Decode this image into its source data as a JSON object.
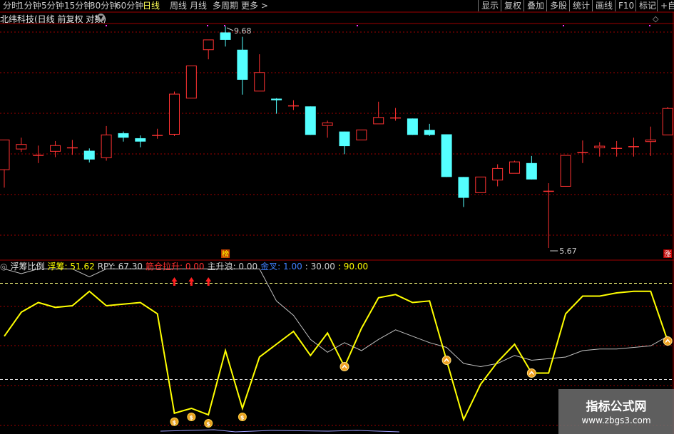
{
  "toolbar": {
    "periods": [
      "分时",
      "1分钟",
      "5分钟",
      "15分钟",
      "30分钟",
      "60分钟",
      "日线",
      "周线",
      "月线",
      "多周期",
      "更多 >"
    ],
    "active_period": "日线",
    "right_buttons": [
      "显示",
      "复权",
      "叠加",
      "多股",
      "统计",
      "画线",
      "F10",
      "标记",
      "+自"
    ]
  },
  "main_chart": {
    "title": "北纬科技(日线 前复权 对数)",
    "high_label": "9.68",
    "low_label": "5.67",
    "marker_bang": "榜",
    "marker_zhang": "涨",
    "candles": [
      {
        "o": 6.85,
        "c": 7.36,
        "h": 7.36,
        "l": 6.56
      },
      {
        "o": 7.2,
        "c": 7.28,
        "h": 7.4,
        "l": 7.15
      },
      {
        "o": 7.1,
        "c": 7.1,
        "h": 7.26,
        "l": 6.96
      },
      {
        "o": 7.16,
        "c": 7.26,
        "h": 7.34,
        "l": 7.06
      },
      {
        "o": 7.23,
        "c": 7.23,
        "h": 7.36,
        "l": 7.1
      },
      {
        "o": 7.17,
        "c": 7.02,
        "h": 7.21,
        "l": 6.97
      },
      {
        "o": 7.05,
        "c": 7.45,
        "h": 7.61,
        "l": 7.0
      },
      {
        "o": 7.48,
        "c": 7.4,
        "h": 7.51,
        "l": 7.33
      },
      {
        "o": 7.39,
        "c": 7.33,
        "h": 7.44,
        "l": 7.23
      },
      {
        "o": 7.45,
        "c": 7.45,
        "h": 7.56,
        "l": 7.38
      },
      {
        "o": 7.46,
        "c": 8.22,
        "h": 8.27,
        "l": 7.43
      },
      {
        "o": 8.14,
        "c": 8.8,
        "h": 8.8,
        "l": 8.14
      },
      {
        "o": 9.15,
        "c": 9.37,
        "h": 9.37,
        "l": 8.94
      },
      {
        "o": 9.54,
        "c": 9.37,
        "h": 9.68,
        "l": 9.22
      },
      {
        "o": 9.15,
        "c": 8.51,
        "h": 9.44,
        "l": 8.21
      },
      {
        "o": 8.28,
        "c": 8.66,
        "h": 9.05,
        "l": 8.28
      },
      {
        "o": 8.13,
        "c": 8.1,
        "h": 8.14,
        "l": 7.84
      },
      {
        "o": 8.0,
        "c": 8.0,
        "h": 8.1,
        "l": 7.91
      },
      {
        "o": 7.98,
        "c": 7.45,
        "h": 7.98,
        "l": 7.45
      },
      {
        "o": 7.62,
        "c": 7.67,
        "h": 7.71,
        "l": 7.4
      },
      {
        "o": 7.51,
        "c": 7.25,
        "h": 7.51,
        "l": 7.11
      },
      {
        "o": 7.36,
        "c": 7.54,
        "h": 7.54,
        "l": 7.36
      },
      {
        "o": 7.65,
        "c": 7.77,
        "h": 8.07,
        "l": 7.65
      },
      {
        "o": 7.77,
        "c": 7.77,
        "h": 7.95,
        "l": 7.71
      },
      {
        "o": 7.75,
        "c": 7.45,
        "h": 7.75,
        "l": 7.45
      },
      {
        "o": 7.54,
        "c": 7.45,
        "h": 7.65,
        "l": 7.43
      },
      {
        "o": 7.46,
        "c": 6.73,
        "h": 7.46,
        "l": 6.73
      },
      {
        "o": 6.73,
        "c": 6.4,
        "h": 6.73,
        "l": 6.26
      },
      {
        "o": 6.48,
        "c": 6.73,
        "h": 6.73,
        "l": 6.48
      },
      {
        "o": 6.68,
        "c": 6.87,
        "h": 6.94,
        "l": 6.58
      },
      {
        "o": 6.79,
        "c": 6.98,
        "h": 7.0,
        "l": 6.79
      },
      {
        "o": 6.96,
        "c": 6.69,
        "h": 7.08,
        "l": 6.69
      },
      {
        "o": 6.51,
        "c": 6.51,
        "h": 6.63,
        "l": 5.67
      },
      {
        "o": 6.58,
        "c": 7.09,
        "h": 7.09,
        "l": 6.58
      },
      {
        "o": 7.15,
        "c": 7.15,
        "h": 7.35,
        "l": 6.96
      },
      {
        "o": 7.22,
        "c": 7.25,
        "h": 7.32,
        "l": 7.07
      },
      {
        "o": 7.22,
        "c": 7.22,
        "h": 7.34,
        "l": 7.07
      },
      {
        "o": 7.25,
        "c": 7.25,
        "h": 7.4,
        "l": 7.07
      },
      {
        "o": 7.33,
        "c": 7.36,
        "h": 7.6,
        "l": 7.08
      },
      {
        "o": 7.45,
        "c": 7.94,
        "h": 7.97,
        "l": 7.45
      }
    ]
  },
  "indicator": {
    "name": "浮筹比例",
    "items": [
      {
        "label": "浮筹: 51.62",
        "color": "#ffff00"
      },
      {
        "label": "RPY: 67.30",
        "color": "#d0d0d0"
      },
      {
        "label": "筋仓拉升: 0.00",
        "color": "#ff3030"
      },
      {
        "label": "主升浪: 0.00",
        "color": "#d0d0d0"
      },
      {
        "label": "金叉: 1.00",
        "color": "#4080ff"
      },
      {
        "label": ": 30.00",
        "color": "#d0d0d0"
      },
      {
        "label": ": 90.00",
        "color": "#ffff00"
      }
    ],
    "yellow": [
      57,
      72,
      78,
      75,
      76,
      85,
      76,
      77,
      78,
      71,
      9,
      12,
      8,
      48,
      12,
      44,
      52,
      60,
      45,
      59,
      38,
      62,
      81,
      83,
      78,
      79,
      42,
      5,
      27,
      41,
      52,
      34,
      34,
      71,
      82,
      82,
      84,
      85,
      85,
      54
    ],
    "white": [
      99,
      96,
      99,
      99,
      99,
      94,
      99,
      99,
      99,
      99,
      99,
      99,
      99,
      99,
      99,
      99,
      79,
      70,
      55,
      47,
      53,
      48,
      55,
      61,
      57,
      53,
      50,
      40,
      38,
      40,
      45,
      42,
      43,
      44,
      48,
      49,
      49,
      50,
      51,
      57
    ],
    "ref_line_high": 90,
    "ref_line_low": 30,
    "arrow_indices": [
      10,
      11,
      12
    ],
    "money_indices": [
      10,
      11,
      12,
      14
    ],
    "cross_indices": [
      20,
      26,
      31,
      39
    ]
  },
  "watermark": {
    "title": "指标公式网",
    "url": "www.zbgs3.com"
  },
  "colors": {
    "up": "#ff3232",
    "down": "#54ffff",
    "grid": "#a00000",
    "yellow": "#ffff00",
    "white": "#c0c0c0"
  }
}
